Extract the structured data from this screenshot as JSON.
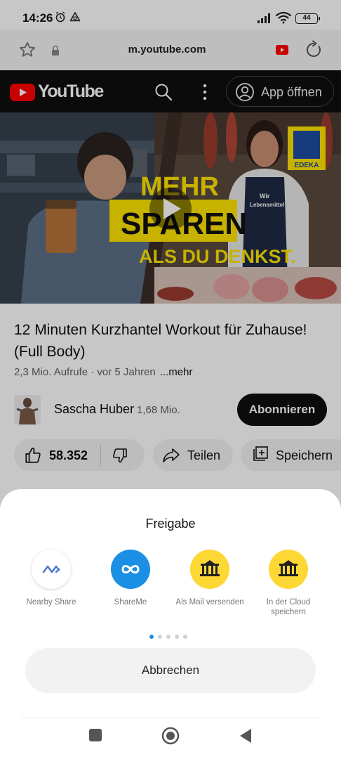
{
  "status_bar": {
    "time": "14:26",
    "battery": "44"
  },
  "browser": {
    "url": "m.youtube.com"
  },
  "youtube": {
    "logo_text": "YouTube",
    "open_app_label": "App öffnen",
    "video": {
      "title": "12 Minuten Kurzhantel Workout für Zuhause! (Full Body)",
      "meta": "2,3 Mio. Aufrufe · vor 5 Jahren",
      "more_label": "...mehr",
      "ad_headline_1": "MEHR",
      "ad_headline_2": "SPAREN",
      "ad_headline_3": "ALS DU DENKST.",
      "ad_brand": "EDEKA",
      "ad_apron_1": "Wir",
      "ad_apron_2": "Lebensmittel"
    },
    "channel": {
      "name": "Sascha Huber",
      "subscribers": "1,68 Mio.",
      "subscribe_label": "Abonnieren"
    },
    "actions": {
      "likes": "58.352",
      "share_label": "Teilen",
      "save_label": "Speichern"
    }
  },
  "share_sheet": {
    "title": "Freigabe",
    "targets": [
      {
        "label": "Nearby Share",
        "icon": "nearby-share-icon"
      },
      {
        "label": "ShareMe",
        "icon": "shareme-icon"
      },
      {
        "label": "Als Mail versenden",
        "icon": "gate-icon"
      },
      {
        "label": "In der Cloud speichern",
        "icon": "gate-icon"
      }
    ],
    "page_count": 5,
    "active_page": 1,
    "cancel_label": "Abbrechen"
  },
  "colors": {
    "youtube_red": "#ff0000",
    "shareme_blue": "#1a8fe3",
    "gate_yellow": "#fdd835",
    "edeka_yellow": "#ffe500",
    "edeka_blue": "#1d4da0"
  }
}
